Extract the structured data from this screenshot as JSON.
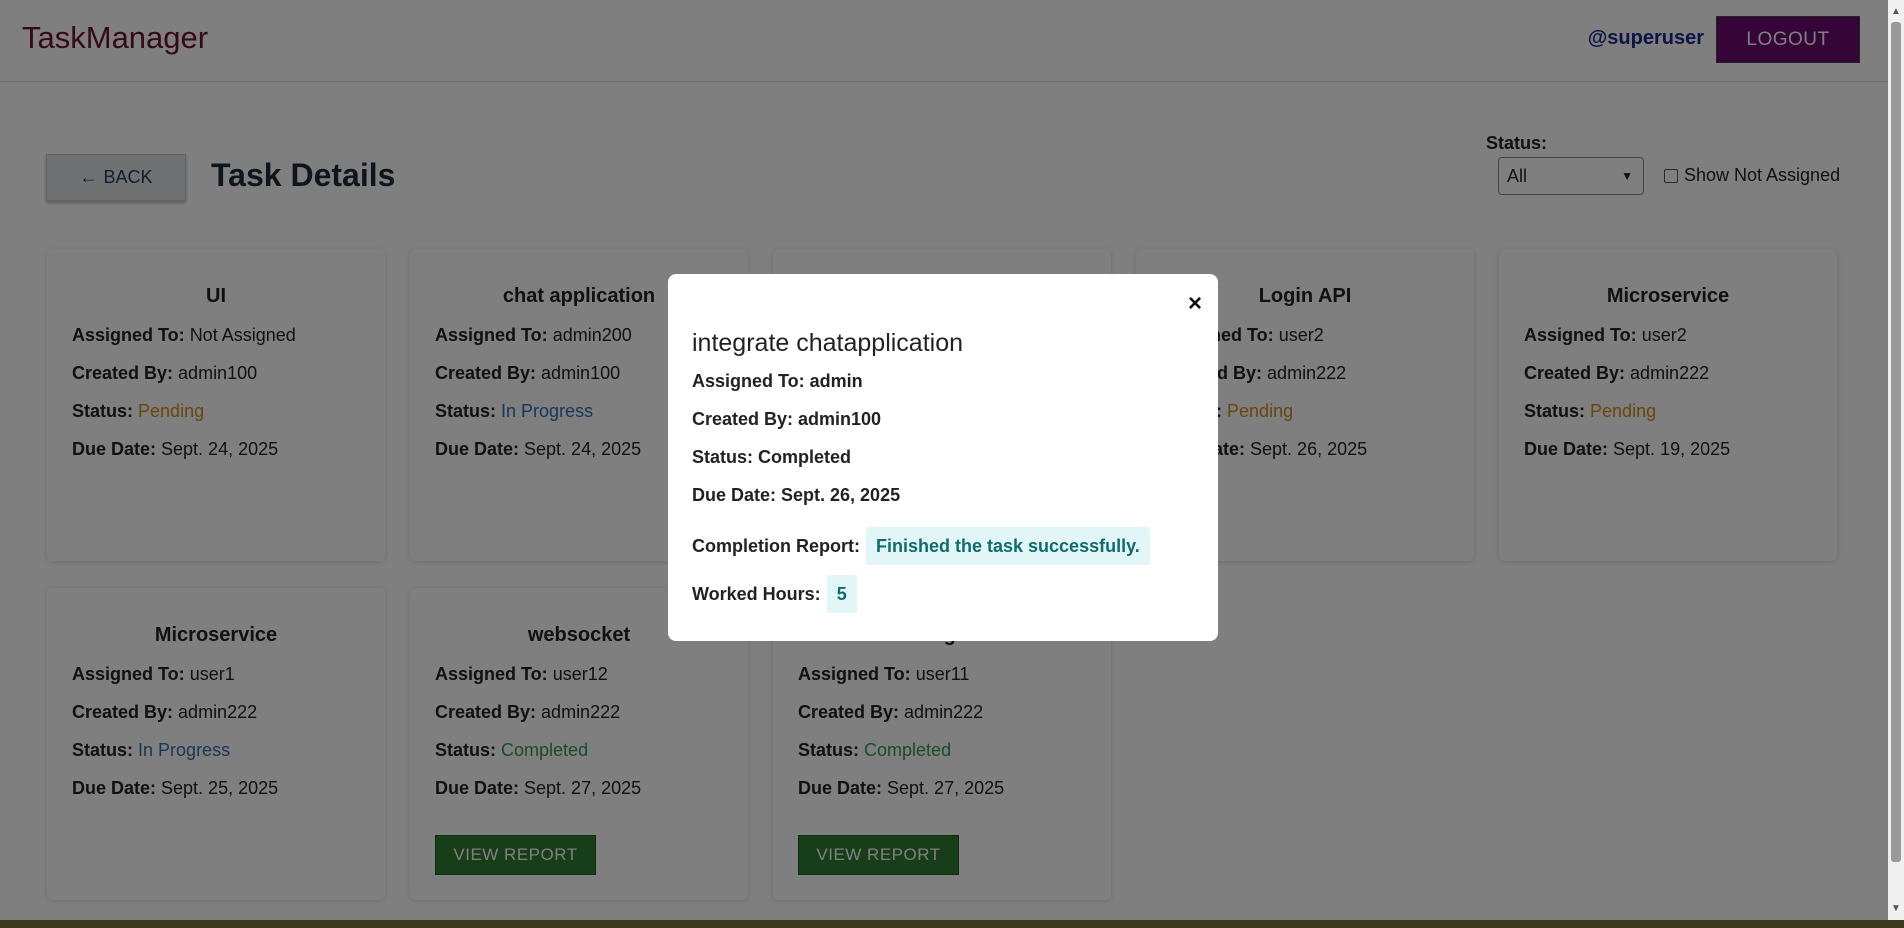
{
  "app": {
    "brand": "TaskManager",
    "username": "@superuser",
    "logout_label": "LOGOUT"
  },
  "toolbar": {
    "back_label": "BACK",
    "back_arrow": "←",
    "page_title": "Task Details",
    "status_filter_label": "Status:",
    "status_filter_value": "All",
    "show_not_assigned_label": "Show Not Assigned"
  },
  "labels": {
    "assigned": "Assigned To:",
    "created": "Created By:",
    "status": "Status:",
    "due": "Due Date:"
  },
  "cards": [
    {
      "title": "UI",
      "assigned": "Not Assigned",
      "created": "admin100",
      "status": "Pending",
      "due": "Sept. 24, 2025"
    },
    {
      "title": "chat application",
      "assigned": "admin200",
      "created": "admin100",
      "status": "In Progress",
      "due": "Sept. 24, 2025"
    },
    {
      "title": "Login API",
      "assigned": "user2",
      "created": "admin222",
      "status": "Pending",
      "due": "Sept. 26, 2025"
    },
    {
      "title": "Microservice",
      "assigned": "user2",
      "created": "admin222",
      "status": "Pending",
      "due": "Sept. 19, 2025"
    },
    {
      "title": "Microservice",
      "assigned": "user1",
      "created": "admin222",
      "status": "In Progress",
      "due": "Sept. 25, 2025"
    },
    {
      "title": "websocket",
      "assigned": "user12",
      "created": "admin222",
      "status": "Completed",
      "due": "Sept. 27, 2025",
      "action": "VIEW REPORT"
    },
    {
      "title": "mailgun",
      "assigned": "user11",
      "created": "admin222",
      "status": "Completed",
      "due": "Sept. 27, 2025",
      "action": "VIEW REPORT"
    }
  ],
  "modal": {
    "close_symbol": "×",
    "title": "integrate chatapplication",
    "assigned": "Assigned To: admin",
    "created": "Created By: admin100",
    "status": "Status: Completed",
    "due": "Due Date: Sept. 26, 2025",
    "report_label": "Completion Report:",
    "report_value": "Finished the task successfully.",
    "hours_label": "Worked Hours:",
    "hours_value": "5"
  },
  "colors": {
    "brand": "#6b1430",
    "logout_bg": "#6a0b6e",
    "pending": "#d18a19",
    "in_progress": "#2f6fb0",
    "completed": "#2e9a4f",
    "view_report_bg": "#2e7d32"
  }
}
